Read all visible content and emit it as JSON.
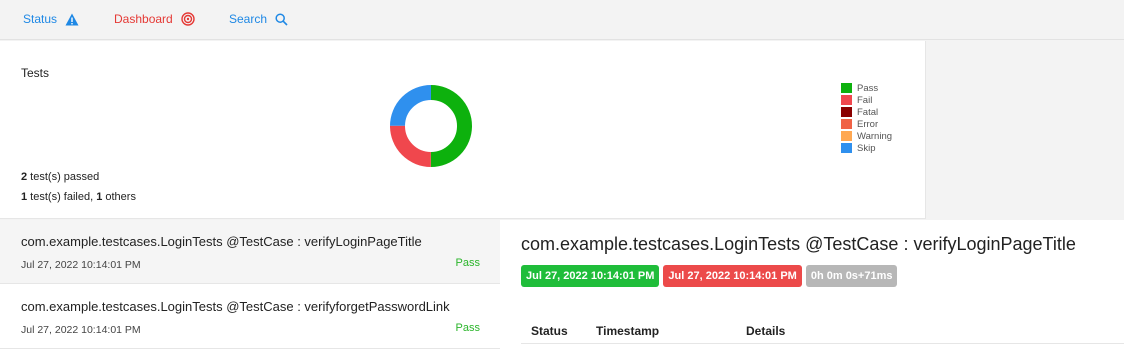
{
  "nav": {
    "status_label": "Status",
    "dashboard_label": "Dashboard",
    "search_label": "Search"
  },
  "dashboard_card": {
    "title": "Tests",
    "passed_count": "2",
    "passed_text": " test(s) passed",
    "failed_count": "1",
    "failed_text": " test(s) failed, ",
    "others_count": "1",
    "others_text": " others"
  },
  "chart_data": {
    "type": "pie",
    "categories": [
      "Pass",
      "Fail",
      "Fatal",
      "Error",
      "Warning",
      "Skip"
    ],
    "values": [
      2,
      1,
      0,
      0,
      0,
      1
    ],
    "colors": [
      "#0db10d",
      "#f0474d",
      "#8b0000",
      "#f06246",
      "#ffa852",
      "#2f90ee"
    ],
    "legend_placement": "right"
  },
  "tests": [
    {
      "name": "com.example.testcases.LoginTests @TestCase : verifyLoginPageTitle",
      "time": "Jul 27, 2022 10:14:01 PM",
      "status": "Pass"
    },
    {
      "name": "com.example.testcases.LoginTests @TestCase : verifyforgetPasswordLink",
      "time": "Jul 27, 2022 10:14:01 PM",
      "status": "Pass"
    }
  ],
  "detail": {
    "title": "com.example.testcases.LoginTests @TestCase : verifyLoginPageTitle",
    "start_time": "Jul 27, 2022 10:14:01 PM",
    "end_time": "Jul 27, 2022 10:14:01 PM",
    "duration": "0h 0m 0s+71ms",
    "columns": [
      "Status",
      "Timestamp",
      "Details"
    ]
  }
}
